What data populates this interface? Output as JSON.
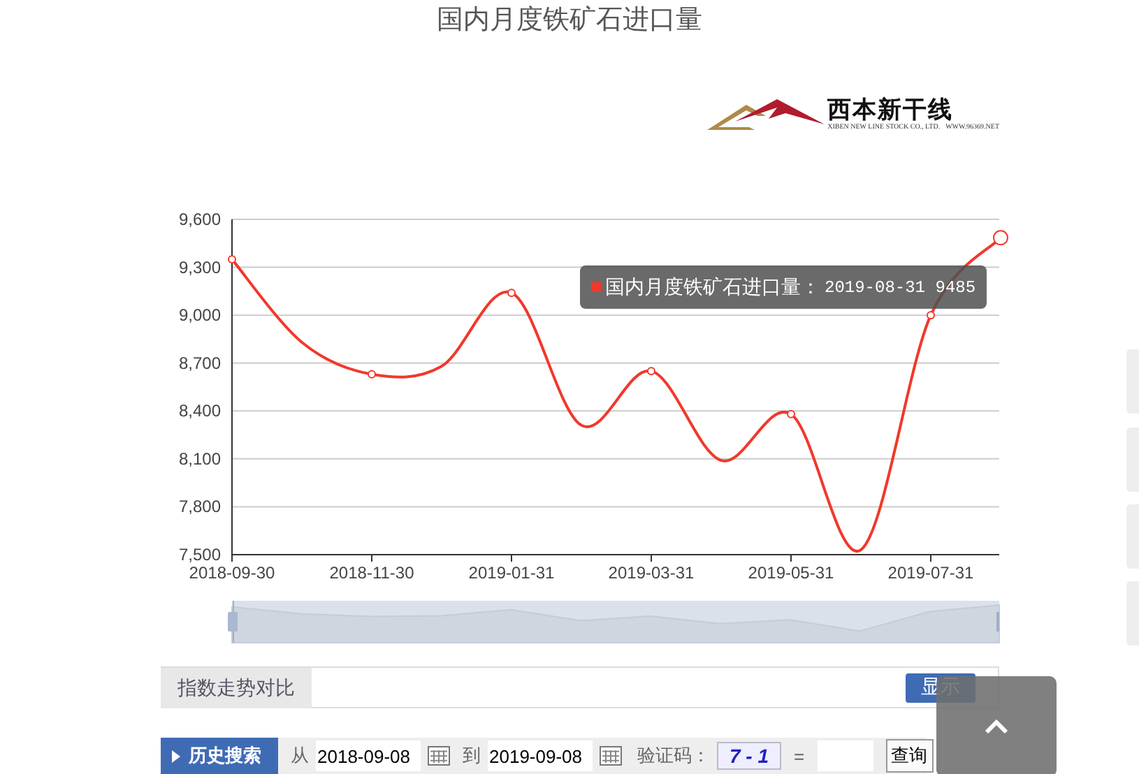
{
  "title": "国内月度铁矿石进口量",
  "logo": {
    "name": "西本新干线",
    "subtitle": "XIBEN NEW LINE STOCK CO., LTD.",
    "url": "WWW.96369.NET"
  },
  "chart": {
    "chart_data": {
      "type": "line",
      "grid": true,
      "categories": [
        "2018-09-30",
        null,
        "2018-11-30",
        null,
        "2019-01-31",
        null,
        "2019-03-31",
        null,
        "2019-05-31",
        null,
        "2019-07-31",
        null
      ],
      "series": [
        {
          "name": "国内月度铁矿石进口量",
          "color": "#f0392b",
          "values": [
            9350,
            8830,
            8630,
            8680,
            9140,
            8310,
            8650,
            8090,
            8380,
            7530,
            9000,
            9485
          ]
        }
      ],
      "ylim": [
        7500,
        9600
      ],
      "yticks": [
        {
          "value": 7500,
          "label": "7,500"
        },
        {
          "value": 7800,
          "label": "7,800"
        },
        {
          "value": 8100,
          "label": "8,100"
        },
        {
          "value": 8400,
          "label": "8,400"
        },
        {
          "value": 8700,
          "label": "8,700"
        },
        {
          "value": 9000,
          "label": "9,000"
        },
        {
          "value": 9300,
          "label": "9,300"
        },
        {
          "value": 9600,
          "label": "9,600"
        }
      ]
    },
    "tooltip": {
      "separator": "：",
      "date": "2019-08-31",
      "value": "9485"
    }
  },
  "compare": {
    "label": "指数走势对比",
    "button": "显示"
  },
  "history": {
    "label": "历史搜索",
    "from_label": "从",
    "from": "2018-09-08",
    "to_label": "到",
    "to": "2019-09-08",
    "captcha_label": "验证码：",
    "captcha": "7 - 1",
    "equals": "=",
    "button": "查询"
  }
}
